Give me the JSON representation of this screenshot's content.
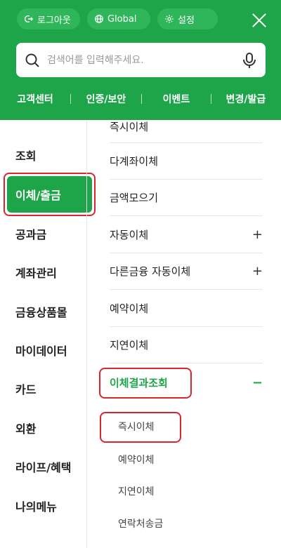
{
  "header": {
    "logout_label": "로그아웃",
    "global_label": "Global",
    "settings_label": "설정",
    "search_placeholder": "검색어를 입력해주세요.",
    "quick_links": [
      "고객센터",
      "인증/보안",
      "이벤트",
      "변경/발급"
    ]
  },
  "left_menu": {
    "items": [
      "조회",
      "이체/출금",
      "공과금",
      "계좌관리",
      "금융상품몰",
      "마이데이터",
      "카드",
      "외환",
      "라이프/혜택",
      "나의메뉴"
    ],
    "active": "이체/출금"
  },
  "right_menu": {
    "top_cut": "즉시이체",
    "items": [
      {
        "label": "다계좌이체",
        "toggle": ""
      },
      {
        "label": "금액모으기",
        "toggle": ""
      },
      {
        "label": "자동이체",
        "toggle": "+"
      },
      {
        "label": "다른금융 자동이체",
        "toggle": "+"
      },
      {
        "label": "예약이체",
        "toggle": ""
      },
      {
        "label": "지연이체",
        "toggle": ""
      },
      {
        "label": "이체결과조회",
        "toggle": "−"
      }
    ],
    "sub_items": [
      "즉시이체",
      "예약이체",
      "지연이체",
      "연락처송금"
    ]
  },
  "colors": {
    "brand_green": "#1ea549",
    "highlight_red": "#d9262c"
  }
}
